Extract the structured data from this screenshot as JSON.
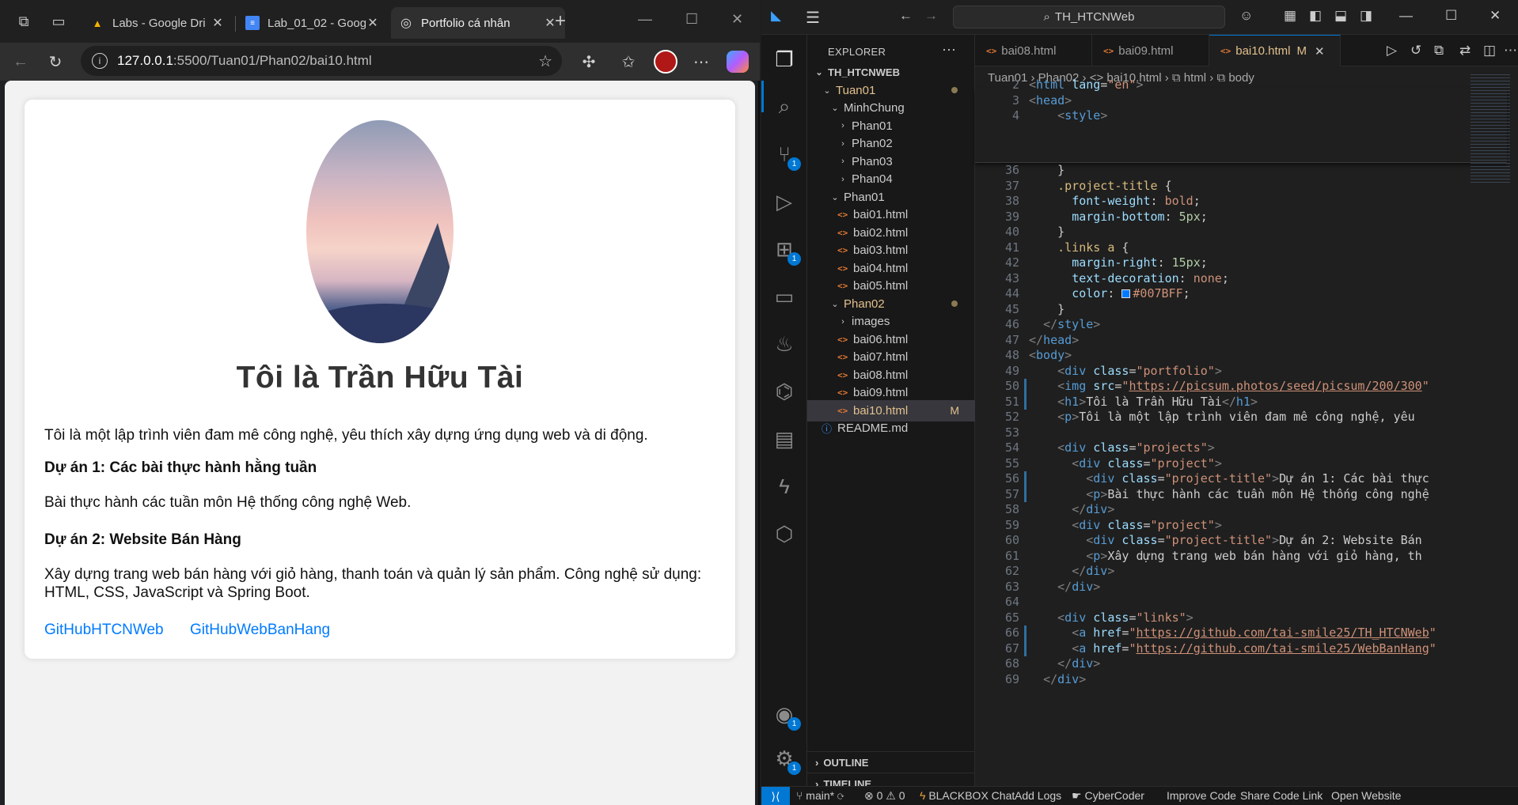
{
  "browser": {
    "tabs": [
      {
        "title": "Labs - Google Dri",
        "icon": "google-drive-icon"
      },
      {
        "title": "Lab_01_02 - Goog",
        "icon": "google-docs-icon"
      },
      {
        "title": "Portfolio cá nhân",
        "icon": "globe-icon"
      }
    ],
    "url_host": "127.0.0.1",
    "url_path": ":5500/Tuan01/Phan02/bai10.html"
  },
  "page": {
    "name": "Tôi là Trần Hữu Tài",
    "intro": "Tôi là một lập trình viên đam mê công nghệ, yêu thích xây dựng ứng dụng web và di động.",
    "projects": [
      {
        "title": "Dự án 1: Các bài thực hành hằng tuần",
        "desc": "Bài thực hành các tuần môn Hệ thống công nghệ Web."
      },
      {
        "title": "Dự án 2: Website Bán Hàng",
        "desc": "Xây dựng trang web bán hàng với giỏ hàng, thanh toán và quản lý sản phẩm. Công nghệ sử dụng: HTML, CSS, JavaScript và Spring Boot."
      }
    ],
    "links": [
      "GitHubHTCNWeb",
      "GitHubWebBanHang"
    ],
    "link_color": "#007BFF"
  },
  "vscode": {
    "search": "TH_HTCNWeb",
    "explorer_title": "EXPLORER",
    "more": "···",
    "tree": [
      {
        "label": "TH_HTCNWEB",
        "kind": "root",
        "chev": "⌄"
      },
      {
        "label": "Tuan01",
        "kind": "folder",
        "chev": "⌄",
        "mod": true
      },
      {
        "label": "MinhChung",
        "kind": "folder",
        "chev": "⌄"
      },
      {
        "label": "Phan01",
        "kind": "folder",
        "chev": "›"
      },
      {
        "label": "Phan02",
        "kind": "folder",
        "chev": "›"
      },
      {
        "label": "Phan03",
        "kind": "folder",
        "chev": "›"
      },
      {
        "label": "Phan04",
        "kind": "folder",
        "chev": "›"
      },
      {
        "label": "Phan01",
        "kind": "folder",
        "chev": "⌄"
      },
      {
        "label": "bai01.html",
        "kind": "file"
      },
      {
        "label": "bai02.html",
        "kind": "file"
      },
      {
        "label": "bai03.html",
        "kind": "file"
      },
      {
        "label": "bai04.html",
        "kind": "file"
      },
      {
        "label": "bai05.html",
        "kind": "file"
      },
      {
        "label": "Phan02",
        "kind": "folder",
        "chev": "⌄",
        "mod": true
      },
      {
        "label": "images",
        "kind": "folder",
        "chev": "›"
      },
      {
        "label": "bai06.html",
        "kind": "file"
      },
      {
        "label": "bai07.html",
        "kind": "file"
      },
      {
        "label": "bai08.html",
        "kind": "file"
      },
      {
        "label": "bai09.html",
        "kind": "file"
      },
      {
        "label": "bai10.html",
        "kind": "file",
        "selected": true,
        "flag": "M"
      },
      {
        "label": "README.md",
        "kind": "readme"
      }
    ],
    "outline": "OUTLINE",
    "timeline": "TIMELINE",
    "editor_tabs": [
      {
        "label": "bai08.html"
      },
      {
        "label": "bai09.html"
      },
      {
        "label": "bai10.html",
        "flag": "M",
        "active": true
      }
    ],
    "breadcrumbs": "Tuan01 › Phan02 › <> bai10.html › ⧉ html › ⧉ body",
    "code_lines": [
      {
        "n": "2",
        "html": "<span class='tg'>&lt;</span><span class='tn'>html</span> <span class='at'>lang</span><span class='tx'>=</span><span class='sv'>\"en\"</span><span class='tg'>&gt;</span>"
      },
      {
        "n": "3",
        "html": "<span class='tg'>&lt;</span><span class='tn'>head</span><span class='tg'>&gt;</span>"
      },
      {
        "n": "4",
        "html": "    <span class='tg'>&lt;</span><span class='tn'>style</span><span class='tg'>&gt;</span>"
      },
      {
        "n": "36",
        "html": "    }"
      },
      {
        "n": "37",
        "html": "    <span class='sl'>.project-title</span> {"
      },
      {
        "n": "38",
        "html": "      <span class='pr'>font-weight</span>: <span class='vl'>bold</span>;"
      },
      {
        "n": "39",
        "html": "      <span class='pr'>margin-bottom</span>: <span class='nm'>5px</span>;"
      },
      {
        "n": "40",
        "html": "    }"
      },
      {
        "n": "41",
        "html": "    <span class='sl'>.links a</span> {"
      },
      {
        "n": "42",
        "html": "      <span class='pr'>margin-right</span>: <span class='nm'>15px</span>;"
      },
      {
        "n": "43",
        "html": "      <span class='pr'>text-decoration</span>: <span class='vl'>none</span>;"
      },
      {
        "n": "44",
        "html": "      <span class='pr'>color</span>: <span class='swatch'></span><span class='vl'>#007BFF</span>;"
      },
      {
        "n": "45",
        "html": "    }"
      },
      {
        "n": "46",
        "html": "  <span class='tg'>&lt;/</span><span class='tn'>style</span><span class='tg'>&gt;</span>"
      },
      {
        "n": "47",
        "html": "<span class='tg'>&lt;/</span><span class='tn'>head</span><span class='tg'>&gt;</span>"
      },
      {
        "n": "48",
        "html": "<span class='tg'>&lt;</span><span class='tn'>body</span><span class='tg'>&gt;</span>"
      },
      {
        "n": "49",
        "html": "    <span class='tg'>&lt;</span><span class='tn'>div</span> <span class='at'>class</span>=<span class='sv'>\"portfolio\"</span><span class='tg'>&gt;</span>"
      },
      {
        "n": "50",
        "html": "    <span class='tg'>&lt;</span><span class='tn'>img</span> <span class='at'>src</span>=<span class='sv'>\"<span class='ul'>https://picsum.photos/seed/picsum/200/300</span>\"</span>"
      },
      {
        "n": "51",
        "html": "    <span class='tg'>&lt;</span><span class='tn'>h1</span><span class='tg'>&gt;</span>Tôi là Trần Hữu Tài<span class='tg'>&lt;/</span><span class='tn'>h1</span><span class='tg'>&gt;</span>"
      },
      {
        "n": "52",
        "html": "    <span class='tg'>&lt;</span><span class='tn'>p</span><span class='tg'>&gt;</span>Tôi là một lập trình viên đam mê công nghệ, yêu"
      },
      {
        "n": "53",
        "html": ""
      },
      {
        "n": "54",
        "html": "    <span class='tg'>&lt;</span><span class='tn'>div</span> <span class='at'>class</span>=<span class='sv'>\"projects\"</span><span class='tg'>&gt;</span>"
      },
      {
        "n": "55",
        "html": "      <span class='tg'>&lt;</span><span class='tn'>div</span> <span class='at'>class</span>=<span class='sv'>\"project\"</span><span class='tg'>&gt;</span>"
      },
      {
        "n": "56",
        "html": "        <span class='tg'>&lt;</span><span class='tn'>div</span> <span class='at'>class</span>=<span class='sv'>\"project-title\"</span><span class='tg'>&gt;</span>Dự án 1: Các bài thực"
      },
      {
        "n": "57",
        "html": "        <span class='tg'>&lt;</span><span class='tn'>p</span><span class='tg'>&gt;</span>Bài thực hành các tuần môn Hệ thống công nghệ"
      },
      {
        "n": "58",
        "html": "      <span class='tg'>&lt;/</span><span class='tn'>div</span><span class='tg'>&gt;</span>"
      },
      {
        "n": "59",
        "html": "      <span class='tg'>&lt;</span><span class='tn'>div</span> <span class='at'>class</span>=<span class='sv'>\"project\"</span><span class='tg'>&gt;</span>"
      },
      {
        "n": "60",
        "html": "        <span class='tg'>&lt;</span><span class='tn'>div</span> <span class='at'>class</span>=<span class='sv'>\"project-title\"</span><span class='tg'>&gt;</span>Dự án 2: Website Bán"
      },
      {
        "n": "61",
        "html": "        <span class='tg'>&lt;</span><span class='tn'>p</span><span class='tg'>&gt;</span>Xây dựng trang web bán hàng với giỏ hàng, th"
      },
      {
        "n": "62",
        "html": "      <span class='tg'>&lt;/</span><span class='tn'>div</span><span class='tg'>&gt;</span>"
      },
      {
        "n": "63",
        "html": "    <span class='tg'>&lt;/</span><span class='tn'>div</span><span class='tg'>&gt;</span>"
      },
      {
        "n": "64",
        "html": ""
      },
      {
        "n": "65",
        "html": "    <span class='tg'>&lt;</span><span class='tn'>div</span> <span class='at'>class</span>=<span class='sv'>\"links\"</span><span class='tg'>&gt;</span>"
      },
      {
        "n": "66",
        "html": "      <span class='tg'>&lt;</span><span class='tn'>a</span> <span class='at'>href</span>=<span class='sv'>\"<span class='ul'>https://github.com/tai-smile25/TH_HTCNWeb</span>\"</span>"
      },
      {
        "n": "67",
        "html": "      <span class='tg'>&lt;</span><span class='tn'>a</span> <span class='at'>href</span>=<span class='sv'>\"<span class='ul'>https://github.com/tai-smile25/WebBanHang</span>\"</span>"
      },
      {
        "n": "68",
        "html": "    <span class='tg'>&lt;/</span><span class='tn'>div</span><span class='tg'>&gt;</span>"
      },
      {
        "n": "69",
        "html": "  <span class='tg'>&lt;/</span><span class='tn'>div</span><span class='tg'>&gt;</span>"
      }
    ],
    "status": {
      "branch": "main*",
      "problems": "⊗ 0 ⚠ 0",
      "blackbox": "BLACKBOX Chat",
      "addlogs": "Add Logs",
      "cybercoder": "CyberCoder",
      "improve": "Improve Code",
      "share": "Share Code Link",
      "open": "Open Website"
    }
  }
}
